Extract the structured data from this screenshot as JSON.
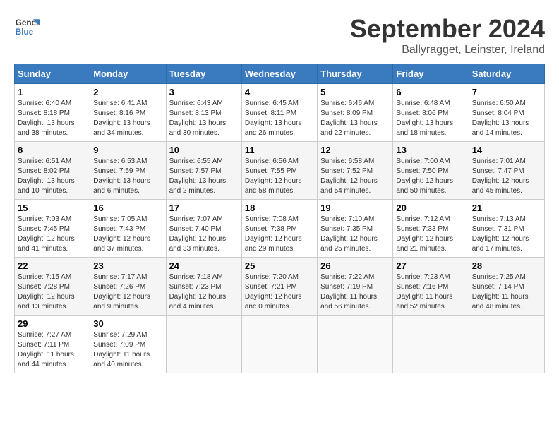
{
  "logo": {
    "line1": "General",
    "line2": "Blue"
  },
  "title": "September 2024",
  "subtitle": "Ballyragget, Leinster, Ireland",
  "headers": [
    "Sunday",
    "Monday",
    "Tuesday",
    "Wednesday",
    "Thursday",
    "Friday",
    "Saturday"
  ],
  "weeks": [
    [
      {
        "day": "1",
        "info": "Sunrise: 6:40 AM\nSunset: 8:18 PM\nDaylight: 13 hours\nand 38 minutes."
      },
      {
        "day": "2",
        "info": "Sunrise: 6:41 AM\nSunset: 8:16 PM\nDaylight: 13 hours\nand 34 minutes."
      },
      {
        "day": "3",
        "info": "Sunrise: 6:43 AM\nSunset: 8:13 PM\nDaylight: 13 hours\nand 30 minutes."
      },
      {
        "day": "4",
        "info": "Sunrise: 6:45 AM\nSunset: 8:11 PM\nDaylight: 13 hours\nand 26 minutes."
      },
      {
        "day": "5",
        "info": "Sunrise: 6:46 AM\nSunset: 8:09 PM\nDaylight: 13 hours\nand 22 minutes."
      },
      {
        "day": "6",
        "info": "Sunrise: 6:48 AM\nSunset: 8:06 PM\nDaylight: 13 hours\nand 18 minutes."
      },
      {
        "day": "7",
        "info": "Sunrise: 6:50 AM\nSunset: 8:04 PM\nDaylight: 13 hours\nand 14 minutes."
      }
    ],
    [
      {
        "day": "8",
        "info": "Sunrise: 6:51 AM\nSunset: 8:02 PM\nDaylight: 13 hours\nand 10 minutes."
      },
      {
        "day": "9",
        "info": "Sunrise: 6:53 AM\nSunset: 7:59 PM\nDaylight: 13 hours\nand 6 minutes."
      },
      {
        "day": "10",
        "info": "Sunrise: 6:55 AM\nSunset: 7:57 PM\nDaylight: 13 hours\nand 2 minutes."
      },
      {
        "day": "11",
        "info": "Sunrise: 6:56 AM\nSunset: 7:55 PM\nDaylight: 12 hours\nand 58 minutes."
      },
      {
        "day": "12",
        "info": "Sunrise: 6:58 AM\nSunset: 7:52 PM\nDaylight: 12 hours\nand 54 minutes."
      },
      {
        "day": "13",
        "info": "Sunrise: 7:00 AM\nSunset: 7:50 PM\nDaylight: 12 hours\nand 50 minutes."
      },
      {
        "day": "14",
        "info": "Sunrise: 7:01 AM\nSunset: 7:47 PM\nDaylight: 12 hours\nand 45 minutes."
      }
    ],
    [
      {
        "day": "15",
        "info": "Sunrise: 7:03 AM\nSunset: 7:45 PM\nDaylight: 12 hours\nand 41 minutes."
      },
      {
        "day": "16",
        "info": "Sunrise: 7:05 AM\nSunset: 7:43 PM\nDaylight: 12 hours\nand 37 minutes."
      },
      {
        "day": "17",
        "info": "Sunrise: 7:07 AM\nSunset: 7:40 PM\nDaylight: 12 hours\nand 33 minutes."
      },
      {
        "day": "18",
        "info": "Sunrise: 7:08 AM\nSunset: 7:38 PM\nDaylight: 12 hours\nand 29 minutes."
      },
      {
        "day": "19",
        "info": "Sunrise: 7:10 AM\nSunset: 7:35 PM\nDaylight: 12 hours\nand 25 minutes."
      },
      {
        "day": "20",
        "info": "Sunrise: 7:12 AM\nSunset: 7:33 PM\nDaylight: 12 hours\nand 21 minutes."
      },
      {
        "day": "21",
        "info": "Sunrise: 7:13 AM\nSunset: 7:31 PM\nDaylight: 12 hours\nand 17 minutes."
      }
    ],
    [
      {
        "day": "22",
        "info": "Sunrise: 7:15 AM\nSunset: 7:28 PM\nDaylight: 12 hours\nand 13 minutes."
      },
      {
        "day": "23",
        "info": "Sunrise: 7:17 AM\nSunset: 7:26 PM\nDaylight: 12 hours\nand 9 minutes."
      },
      {
        "day": "24",
        "info": "Sunrise: 7:18 AM\nSunset: 7:23 PM\nDaylight: 12 hours\nand 4 minutes."
      },
      {
        "day": "25",
        "info": "Sunrise: 7:20 AM\nSunset: 7:21 PM\nDaylight: 12 hours\nand 0 minutes."
      },
      {
        "day": "26",
        "info": "Sunrise: 7:22 AM\nSunset: 7:19 PM\nDaylight: 11 hours\nand 56 minutes."
      },
      {
        "day": "27",
        "info": "Sunrise: 7:23 AM\nSunset: 7:16 PM\nDaylight: 11 hours\nand 52 minutes."
      },
      {
        "day": "28",
        "info": "Sunrise: 7:25 AM\nSunset: 7:14 PM\nDaylight: 11 hours\nand 48 minutes."
      }
    ],
    [
      {
        "day": "29",
        "info": "Sunrise: 7:27 AM\nSunset: 7:11 PM\nDaylight: 11 hours\nand 44 minutes."
      },
      {
        "day": "30",
        "info": "Sunrise: 7:29 AM\nSunset: 7:09 PM\nDaylight: 11 hours\nand 40 minutes."
      },
      {
        "day": "",
        "info": ""
      },
      {
        "day": "",
        "info": ""
      },
      {
        "day": "",
        "info": ""
      },
      {
        "day": "",
        "info": ""
      },
      {
        "day": "",
        "info": ""
      }
    ]
  ]
}
